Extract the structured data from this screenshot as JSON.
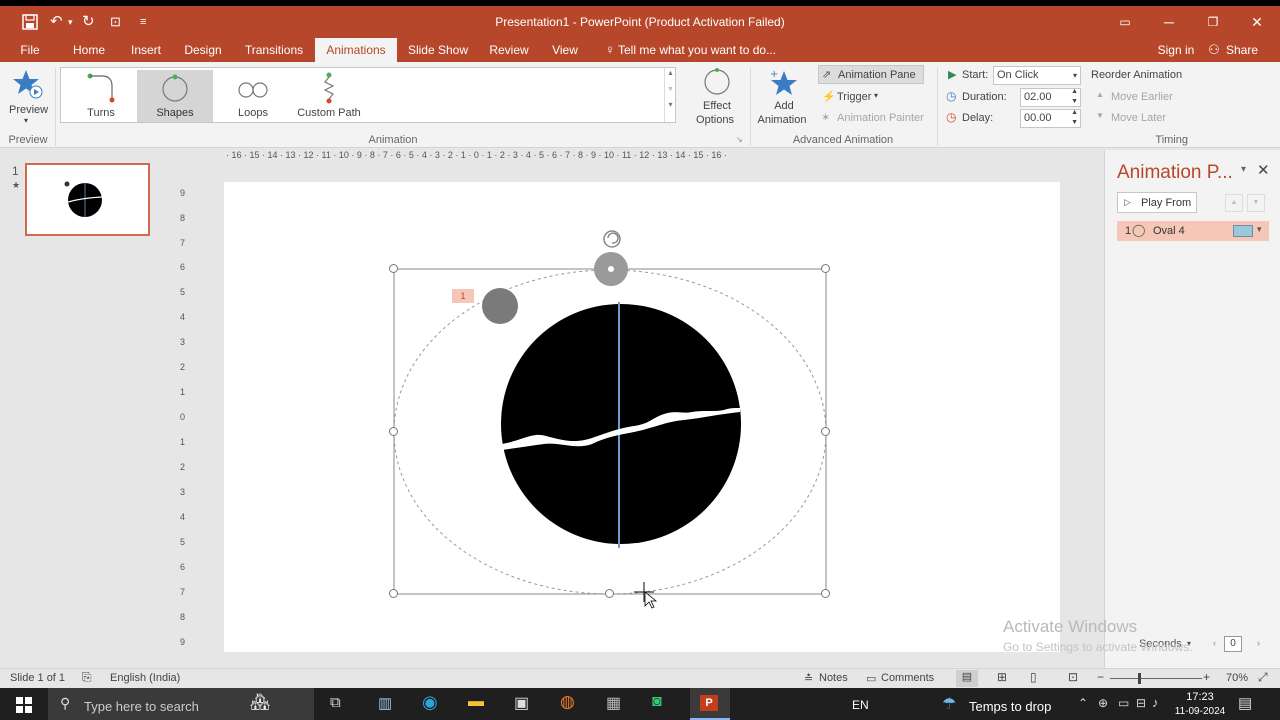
{
  "window": {
    "title": "Presentation1 - PowerPoint (Product Activation Failed)"
  },
  "menu": {
    "file": "File",
    "tabs": [
      "Home",
      "Insert",
      "Design",
      "Transitions",
      "Animations",
      "Slide Show",
      "Review",
      "View"
    ],
    "tell_me": "Tell me what you want to do...",
    "sign_in": "Sign in",
    "share": "Share"
  },
  "ribbon": {
    "preview": {
      "label": "Preview",
      "group": "Preview"
    },
    "animation_gallery": [
      "Turns",
      "Shapes",
      "Loops",
      "Custom Path"
    ],
    "effect_options": [
      "Effect",
      "Options"
    ],
    "animation_group": "Animation",
    "add_animation": [
      "Add",
      "Animation"
    ],
    "animation_pane": "Animation Pane",
    "trigger": "Trigger",
    "animation_painter": "Animation Painter",
    "advanced_group": "Advanced Animation",
    "start_label": "Start:",
    "start_value": "On Click",
    "duration_label": "Duration:",
    "duration_value": "02.00",
    "delay_label": "Delay:",
    "delay_value": "00.00",
    "timing_group": "Timing",
    "reorder": "Reorder Animation",
    "move_earlier": "Move Earlier",
    "move_later": "Move Later"
  },
  "thumbnails": {
    "slide_number": "1",
    "anim_marker": "★"
  },
  "rulers": {
    "horizontal": "· 16 · 15 · 14 · 13 · 12 · 11 · 10 · 9 · 8 · 7 · 6 · 5 · 4 · 3 · 2 · 1 · 0 · 1 · 2 · 3 · 4 · 5 · 6 · 7 · 8 · 9 · 10 · 11 · 12 · 13 · 14 · 15 · 16 ·",
    "vertical": [
      "9",
      "8",
      "7",
      "6",
      "5",
      "4",
      "3",
      "2",
      "1",
      "0",
      "1",
      "2",
      "3",
      "4",
      "5",
      "6",
      "7",
      "8",
      "9"
    ]
  },
  "slide": {
    "anim_tag": "1"
  },
  "anim_pane": {
    "title": "Animation P...",
    "play_from": "Play From",
    "item_number": "1",
    "item_label": "Oval 4",
    "seconds": "Seconds",
    "seconds_value": "0"
  },
  "watermark": {
    "line1": "Activate Windows",
    "line2": "Go to Settings to activate Windows."
  },
  "status": {
    "slide_info": "Slide 1 of 1",
    "language": "English (India)",
    "notes": "Notes",
    "comments": "Comments",
    "zoom": "70%"
  },
  "taskbar": {
    "search_placeholder": "Type here to search",
    "language": "EN",
    "weather": "Temps to drop",
    "time": "17:23",
    "date": "11-09-2024"
  },
  "colors": {
    "accent": "#b7472a",
    "selection": "#f6c7b6",
    "taskbar": "#1f1f1f"
  }
}
